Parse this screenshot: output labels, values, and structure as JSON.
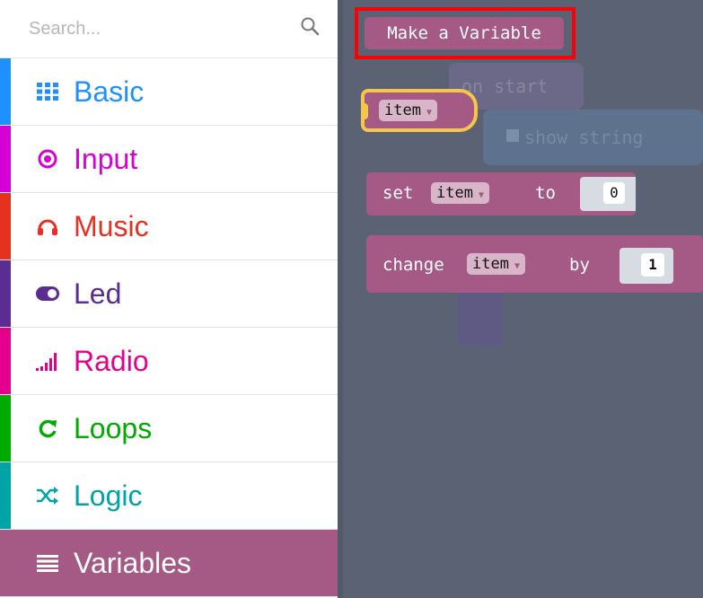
{
  "search": {
    "placeholder": "Search..."
  },
  "categories": [
    {
      "label": "Basic",
      "icon": "grid-icon",
      "color": "#1e90ff"
    },
    {
      "label": "Input",
      "icon": "target-icon",
      "color": "#d400d4"
    },
    {
      "label": "Music",
      "icon": "headphones-icon",
      "color": "#e63022"
    },
    {
      "label": "Led",
      "icon": "toggle-icon",
      "color": "#5c2d91"
    },
    {
      "label": "Radio",
      "icon": "signal-icon",
      "color": "#e3008c"
    },
    {
      "label": "Loops",
      "icon": "refresh-icon",
      "color": "#00aa00"
    },
    {
      "label": "Logic",
      "icon": "shuffle-icon",
      "color": "#00a4a6"
    },
    {
      "label": "Variables",
      "icon": "list-icon",
      "color": "#a45a85"
    }
  ],
  "workspace": {
    "make_variable": "Make a Variable",
    "item_block": "item",
    "set_block": {
      "prefix": "set",
      "var": "item",
      "mid": "to",
      "value": "0"
    },
    "change_block": {
      "prefix": "change",
      "var": "item",
      "mid": "by",
      "value": "1"
    },
    "ghost_on_start": "on start",
    "ghost_show_string": "show string"
  }
}
